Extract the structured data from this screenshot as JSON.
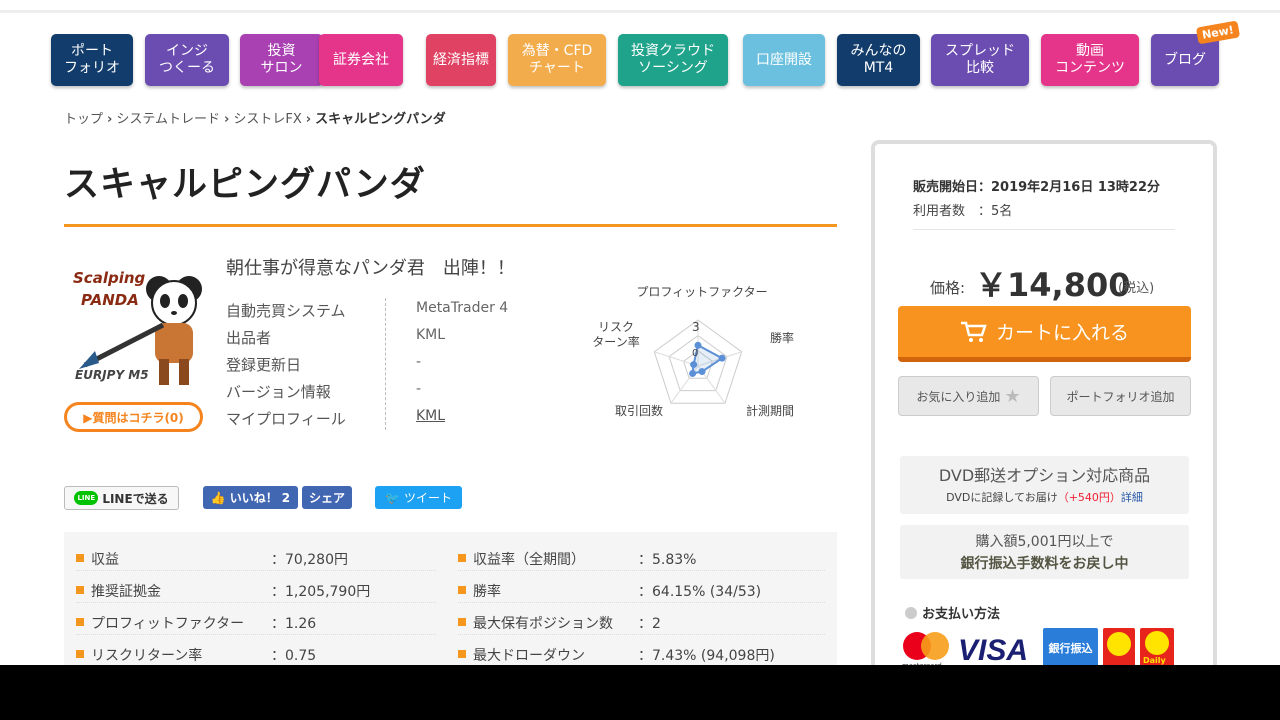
{
  "nav": [
    {
      "label": "ポート\nフォリオ",
      "color": "#123c6b"
    },
    {
      "label": "インジ\nつくーる",
      "color": "#6b4db1"
    },
    {
      "label": "投資\nサロン",
      "color": "#a941b3"
    },
    {
      "label": "証券会社",
      "color": "#e4358b"
    },
    {
      "label": "経済指標",
      "color": "#e04263"
    },
    {
      "label": "為替・CFD\nチャート",
      "color": "#f2ac4b"
    },
    {
      "label": "投資クラウド\nソーシング",
      "color": "#1fa38a"
    },
    {
      "label": "口座開設",
      "color": "#6ac0de"
    },
    {
      "label": "みんなの\nMT4",
      "color": "#123c6b"
    },
    {
      "label": "スプレッド\n比較",
      "color": "#6b4db1"
    },
    {
      "label": "動画\nコンテンツ",
      "color": "#e4358b"
    },
    {
      "label": "ブログ",
      "color": "#6b4db1"
    }
  ],
  "new_badge": "New!",
  "breadcrumb": [
    "トップ",
    "システムトレード",
    "シストレFX",
    "スキャルピングパンダ"
  ],
  "title": "スキャルピングパンダ",
  "logo": {
    "line1": "Scalping",
    "line2": "PANDA",
    "line3": "EURJPY M5"
  },
  "question_button": "▶質問はコチラ(0)",
  "catch": "朝仕事が得意なパンダ君　出陣！！",
  "info": [
    {
      "key": "自動売買システム",
      "value": "MetaTrader 4"
    },
    {
      "key": "出品者",
      "value": "KML"
    },
    {
      "key": "登録更新日",
      "value": "-"
    },
    {
      "key": "バージョン情報",
      "value": "-"
    },
    {
      "key": "マイプロフィール",
      "value": "KML"
    }
  ],
  "radar": {
    "labels": [
      "プロフィットファクター",
      "勝率",
      "計測期間",
      "取引回数",
      "リスク\nターン率"
    ],
    "scale_max": "3",
    "scale_min": "0",
    "values": [
      0.45,
      0.55,
      0.15,
      0.2,
      0.1
    ]
  },
  "share": {
    "line": "LINEで送る",
    "line_icon": "LINE",
    "like": "いいね！",
    "like_count": "2",
    "fb_share": "シェア",
    "tweet": "ツイート"
  },
  "stats_left": [
    {
      "key": "収益",
      "value": "：70,280円"
    },
    {
      "key": "推奨証拠金",
      "value": "：1,205,790円"
    },
    {
      "key": "プロフィットファクター",
      "value": "：1.26"
    },
    {
      "key": "リスクリターン率",
      "value": "：0.75"
    }
  ],
  "stats_right": [
    {
      "key": "収益率（全期間）",
      "value": "：5.83%"
    },
    {
      "key": "勝率",
      "value": "：64.15% (34/53)"
    },
    {
      "key": "最大保有ポジション数",
      "value": "：2"
    },
    {
      "key": "最大ドローダウン",
      "value": "：7.43% (94,098円)"
    }
  ],
  "side": {
    "sale_date": "販売開始日：2019年2月16日 13時22分",
    "users": "利用者数　：5名",
    "price_label": "価格:",
    "price": "￥14,800",
    "tax": "(税込)",
    "cart": "カートに入れる",
    "fav": "お気に入り追加",
    "portfolio": "ポートフォリオ追加",
    "dvd_title": "DVD郵送オプション対応商品",
    "dvd_note": "DVDに記録してお届け",
    "dvd_price": "（+540円）",
    "dvd_detail": "詳細",
    "refund1": "購入額5,001円以上で",
    "refund2": "銀行振込手数料をお戻し中",
    "pay_title": "お支払い方法",
    "pay_visa": "VISA",
    "pay_bank": "銀行振込",
    "pay_mc": "mastercard",
    "pay_daily": "Daily"
  }
}
